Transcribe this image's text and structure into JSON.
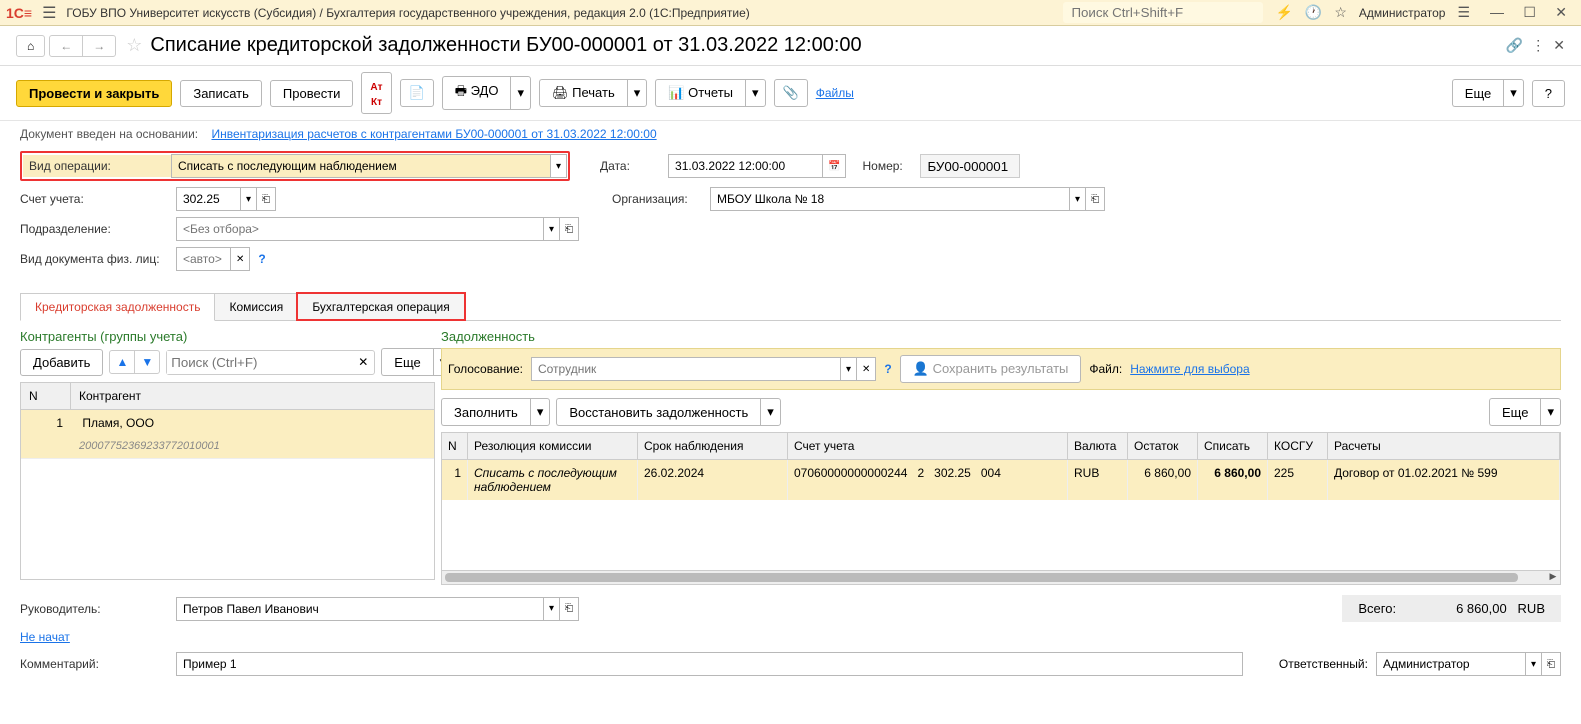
{
  "titlebar": {
    "app_title": "ГОБУ ВПО Университет искусств (Субсидия) / Бухгалтерия государственного учреждения, редакция 2.0  (1С:Предприятие)",
    "search_placeholder": "Поиск Ctrl+Shift+F",
    "user": "Администратор"
  },
  "doc": {
    "title": "Списание кредиторской задолженности БУ00-000001 от 31.03.2022 12:00:00"
  },
  "toolbar": {
    "post_close": "Провести и закрыть",
    "save": "Записать",
    "post": "Провести",
    "edo": "ЭДО",
    "print": "Печать",
    "reports": "Отчеты",
    "files": "Файлы",
    "more": "Еще",
    "help": "?"
  },
  "info": {
    "label": "Документ введен на основании:",
    "link": "Инвентаризация расчетов с контрагентами БУ00-000001 от 31.03.2022 12:00:00"
  },
  "form": {
    "op_type_label": "Вид операции:",
    "op_type_value": "Списать с последующим наблюдением",
    "date_label": "Дата:",
    "date_value": "31.03.2022 12:00:00",
    "number_label": "Номер:",
    "number_value": "БУ00-000001",
    "account_label": "Счет учета:",
    "account_value": "302.25",
    "org_label": "Организация:",
    "org_value": "МБОУ Школа № 18",
    "dept_label": "Подразделение:",
    "dept_placeholder": "<Без отбора>",
    "doctype_label": "Вид документа физ. лиц:",
    "doctype_placeholder": "<авто>"
  },
  "tabs": {
    "t1": "Кредиторская задолженность",
    "t2": "Комиссия",
    "t3": "Бухгалтерская операция"
  },
  "left": {
    "section": "Контрагенты (группы учета)",
    "add": "Добавить",
    "search_placeholder": "Поиск (Ctrl+F)",
    "more": "Еще",
    "col_n": "N",
    "col_k": "Контрагент",
    "row_n": "1",
    "row_k": "Пламя, ООО",
    "row_sub": "20007752369233772010001"
  },
  "right": {
    "section": "Задолженность",
    "voting_label": "Голосование:",
    "voting_placeholder": "Сотрудник",
    "save_results": "Сохранить результаты",
    "file_label": "Файл:",
    "file_link": "Нажмите для выбора",
    "fill": "Заполнить",
    "restore": "Восстановить задолженность",
    "more": "Еще",
    "cols": {
      "n": "N",
      "res": "Резолюция комиссии",
      "term": "Срок наблюдения",
      "acct": "Счет учета",
      "curr": "Валюта",
      "balance": "Остаток",
      "writeoff": "Списать",
      "kosgu": "КОСГУ",
      "calc": "Расчеты"
    },
    "row": {
      "n": "1",
      "res": "Списать с последующим наблюдением",
      "term": "26.02.2024",
      "acct1": "07060000000000244",
      "acct2": "2",
      "acct3": "302.25",
      "acct4": "004",
      "curr": "RUB",
      "balance": "6 860,00",
      "writeoff": "6 860,00",
      "kosgu": "225",
      "calc": "Договор от 01.02.2021 № 599"
    }
  },
  "footer": {
    "leader_label": "Руководитель:",
    "leader_value": "Петров Павел Иванович",
    "not_started": "Не начат",
    "comment_label": "Комментарий:",
    "comment_value": "Пример 1",
    "total_label": "Всего:",
    "total_value": "6 860,00",
    "total_curr": "RUB",
    "resp_label": "Ответственный:",
    "resp_value": "Администратор"
  }
}
